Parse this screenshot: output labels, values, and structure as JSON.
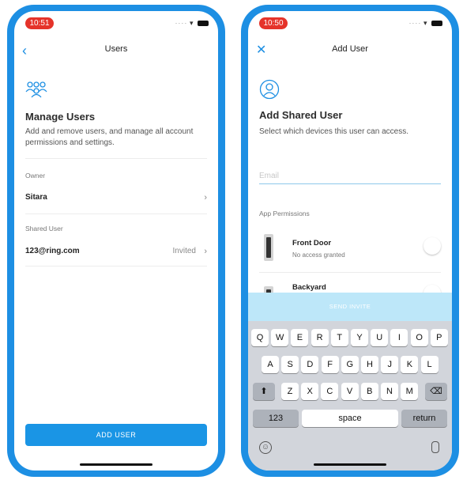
{
  "left": {
    "status_time": "10:51",
    "nav_title": "Users",
    "heading": "Manage Users",
    "description": "Add and remove users, and manage all account permissions and settings.",
    "owner_label": "Owner",
    "owner_name": "Sitara",
    "shared_label": "Shared User",
    "shared_email": "123@ring.com",
    "shared_status": "Invited",
    "add_button": "ADD USER"
  },
  "right": {
    "status_time": "10:50",
    "nav_title": "Add User",
    "heading": "Add Shared User",
    "description": "Select which devices this user can access.",
    "email_placeholder": "Email",
    "permissions_label": "App Permissions",
    "devices": [
      {
        "name": "Front Door",
        "status": "No access granted"
      },
      {
        "name": "Backyard",
        "status": ""
      }
    ],
    "send_invite": "SEND INVITE",
    "keyboard": {
      "row1": [
        "Q",
        "W",
        "E",
        "R",
        "T",
        "Y",
        "U",
        "I",
        "O",
        "P"
      ],
      "row2": [
        "A",
        "S",
        "D",
        "F",
        "G",
        "H",
        "J",
        "K",
        "L"
      ],
      "row3": [
        "Z",
        "X",
        "C",
        "V",
        "B",
        "N",
        "M"
      ],
      "numbers": "123",
      "space": "space",
      "return": "return"
    }
  },
  "colors": {
    "frame": "#1d8fe3",
    "button": "#1a95e5",
    "time_pill": "#e5332a",
    "send_bar": "#bde7f9"
  }
}
